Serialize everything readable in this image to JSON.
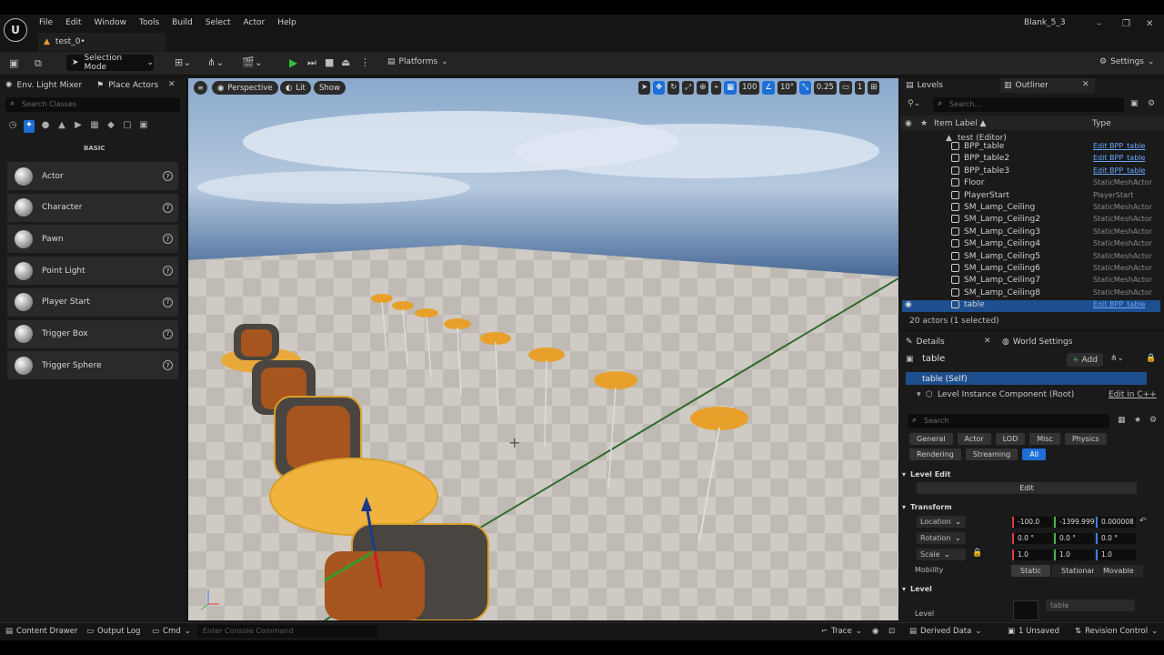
{
  "app": {
    "title": "Blank_5_3",
    "document_tab": "test_0•"
  },
  "menu": [
    "File",
    "Edit",
    "Window",
    "Tools",
    "Build",
    "Select",
    "Actor",
    "Help"
  ],
  "toolbar": {
    "selection_mode": "Selection Mode",
    "platforms": "Platforms",
    "settings": "Settings"
  },
  "left_panel": {
    "tabs": [
      "Env. Light Mixer",
      "Place Actors"
    ],
    "search_placeholder": "Search Classes",
    "category": "BASIC",
    "items": [
      "Actor",
      "Character",
      "Pawn",
      "Point Light",
      "Player Start",
      "Trigger Box",
      "Trigger Sphere"
    ]
  },
  "viewport": {
    "perspective": "Perspective",
    "lit": "Lit",
    "show": "Show",
    "grid_snap": "100",
    "rotation_snap": "10°",
    "scale_snap": "0.25",
    "camera_speed": "1"
  },
  "outliner": {
    "tabs": [
      "Levels",
      "Outliner"
    ],
    "search_placeholder": "Search...",
    "col_label": "Item Label ▲",
    "col_type": "Type",
    "root": "test (Editor)",
    "rows": [
      {
        "name": "BPP_table",
        "type": "Edit BPP_table",
        "link": true,
        "selected": false
      },
      {
        "name": "BPP_table2",
        "type": "Edit BPP_table",
        "link": true,
        "selected": false
      },
      {
        "name": "BPP_table3",
        "type": "Edit BPP_table",
        "link": true,
        "selected": false
      },
      {
        "name": "Floor",
        "type": "StaticMeshActor",
        "link": false,
        "selected": false
      },
      {
        "name": "PlayerStart",
        "type": "PlayerStart",
        "link": false,
        "selected": false
      },
      {
        "name": "SM_Lamp_Ceiling",
        "type": "StaticMeshActor",
        "link": false,
        "selected": false
      },
      {
        "name": "SM_Lamp_Ceiling2",
        "type": "StaticMeshActor",
        "link": false,
        "selected": false
      },
      {
        "name": "SM_Lamp_Ceiling3",
        "type": "StaticMeshActor",
        "link": false,
        "selected": false
      },
      {
        "name": "SM_Lamp_Ceiling4",
        "type": "StaticMeshActor",
        "link": false,
        "selected": false
      },
      {
        "name": "SM_Lamp_Ceiling5",
        "type": "StaticMeshActor",
        "link": false,
        "selected": false
      },
      {
        "name": "SM_Lamp_Ceiling6",
        "type": "StaticMeshActor",
        "link": false,
        "selected": false
      },
      {
        "name": "SM_Lamp_Ceiling7",
        "type": "StaticMeshActor",
        "link": false,
        "selected": false
      },
      {
        "name": "SM_Lamp_Ceiling8",
        "type": "StaticMeshActor",
        "link": false,
        "selected": false
      },
      {
        "name": "table",
        "type": "Edit BPP_table",
        "link": true,
        "selected": true
      }
    ],
    "count": "20 actors (1 selected)"
  },
  "details": {
    "tabs": [
      "Details",
      "World Settings"
    ],
    "actor_name": "table",
    "add_label": "Add",
    "self_label": "table (Self)",
    "component": "Level Instance Component (Root)",
    "edit_cpp": "Edit in C++",
    "search_placeholder": "Search",
    "filters": [
      "General",
      "Actor",
      "LOD",
      "Misc",
      "Physics",
      "Rendering",
      "Streaming",
      "All"
    ],
    "level_edit_section": "Level Edit",
    "edit_button": "Edit",
    "transform_section": "Transform",
    "location_label": "Location",
    "rotation_label": "Rotation",
    "scale_label": "Scale",
    "location": [
      "-100.0",
      "-1399.999",
      "0.000008"
    ],
    "rotation": [
      "0.0 °",
      "0.0 °",
      "0.0 °"
    ],
    "scale": [
      "1.0",
      "1.0",
      "1.0"
    ],
    "mobility_label": "Mobility",
    "mobility": [
      "Static",
      "Stationary",
      "Movable"
    ],
    "level_section": "Level",
    "level_label": "Level",
    "level_value": "table"
  },
  "statusbar": {
    "content_drawer": "Content Drawer",
    "output_log": "Output Log",
    "cmd": "Cmd",
    "console_placeholder": "Enter Console Command",
    "trace": "Trace",
    "derived_data": "Derived Data",
    "unsaved": "1 Unsaved",
    "revision_control": "Revision Control"
  }
}
